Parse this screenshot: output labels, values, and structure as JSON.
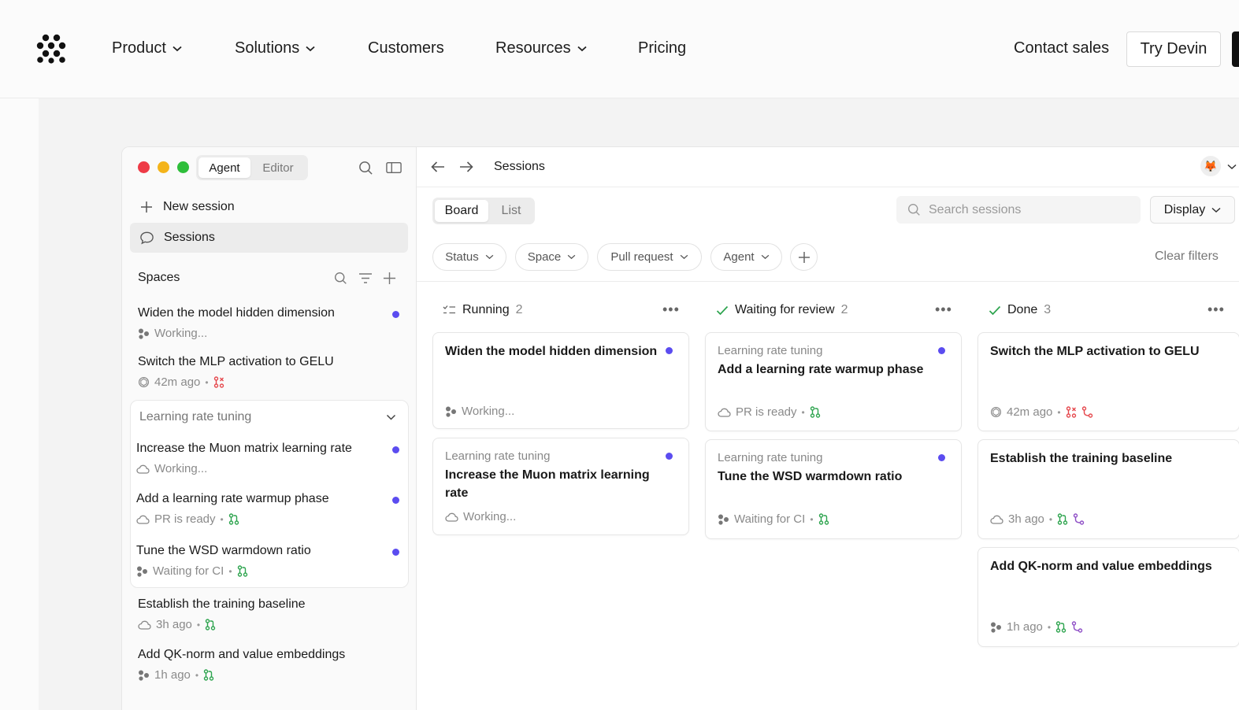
{
  "nav": {
    "items": [
      {
        "label": "Product",
        "has_menu": true
      },
      {
        "label": "Solutions",
        "has_menu": true
      },
      {
        "label": "Customers",
        "has_menu": false
      },
      {
        "label": "Resources",
        "has_menu": true
      },
      {
        "label": "Pricing",
        "has_menu": false
      }
    ],
    "contact_label": "Contact sales",
    "try_label": "Try Devin"
  },
  "sidebar": {
    "tabs": {
      "agent": "Agent",
      "editor": "Editor",
      "active": "Agent"
    },
    "new_session_label": "New session",
    "sessions_label": "Sessions",
    "spaces_title": "Spaces",
    "items": [
      {
        "title": "Widen the model hidden dimension",
        "meta": "Working...",
        "icon": "agent-icon",
        "unread": true
      },
      {
        "title": "Switch the MLP activation to GELU",
        "meta": "42m ago",
        "icon": "openai-icon",
        "pr_status": "pr-closed-icon"
      }
    ],
    "group": {
      "title": "Learning rate tuning",
      "items": [
        {
          "title": "Increase the Muon matrix learning rate",
          "meta": "Working...",
          "icon": "cloud-icon",
          "unread": true
        },
        {
          "title": "Add a learning rate warmup phase",
          "meta": "PR is ready",
          "icon": "cloud-icon",
          "unread": true,
          "pr_status": "pr-open-icon"
        },
        {
          "title": "Tune the WSD warmdown ratio",
          "meta": "Waiting for CI",
          "icon": "agent-icon",
          "unread": true,
          "pr_status": "pr-open-icon"
        }
      ]
    },
    "more_items": [
      {
        "title": "Establish the training baseline",
        "meta": "3h ago",
        "icon": "cloud-icon",
        "pr_status": "pr-open-icon"
      },
      {
        "title": "Add QK-norm and value embeddings",
        "meta": "1h ago",
        "icon": "agent-icon",
        "pr_status": "pr-open-icon"
      }
    ]
  },
  "main": {
    "breadcrumb": "Sessions",
    "view_tabs": {
      "board": "Board",
      "list": "List",
      "active": "Board"
    },
    "search_placeholder": "Search sessions",
    "display_label": "Display",
    "filters": [
      "Status",
      "Space",
      "Pull request",
      "Agent"
    ],
    "clear_filters_label": "Clear filters",
    "columns": [
      {
        "title": "Running",
        "count": "2",
        "icon": "running-icon",
        "cards": [
          {
            "space": "",
            "title": "Widen the model hidden dimension",
            "meta": "Working...",
            "icon": "agent-icon",
            "unread": true
          },
          {
            "space": "Learning rate tuning",
            "title": "Increase the Muon matrix learning rate",
            "meta": "Working...",
            "icon": "cloud-icon",
            "unread": true
          }
        ]
      },
      {
        "title": "Waiting for review",
        "count": "2",
        "icon": "check-icon",
        "cards": [
          {
            "space": "Learning rate tuning",
            "title": "Add a learning rate warmup phase",
            "meta": "PR is ready",
            "icon": "cloud-icon",
            "unread": true,
            "pr_status": "pr-open-icon"
          },
          {
            "space": "Learning rate tuning",
            "title": "Tune the WSD warmdown ratio",
            "meta": "Waiting for CI",
            "icon": "agent-icon",
            "unread": true,
            "pr_status": "pr-open-icon"
          }
        ]
      },
      {
        "title": "Done",
        "count": "3",
        "icon": "check-icon",
        "cards": [
          {
            "space": "",
            "title": "Switch the MLP activation to GELU",
            "meta": "42m ago",
            "icon": "openai-icon",
            "pr_status": "pr-closed-icon",
            "branch": "branch-icon"
          },
          {
            "space": "",
            "title": "Establish the training baseline",
            "meta": "3h ago",
            "icon": "cloud-icon",
            "pr_status": "pr-open-icon",
            "branch": "branch-icon"
          },
          {
            "space": "",
            "title": "Add QK-norm and value embeddings",
            "meta": "1h ago",
            "icon": "agent-icon",
            "pr_status": "pr-open-icon",
            "branch": "branch-icon"
          }
        ]
      }
    ]
  },
  "colors": {
    "accent_dot": "#5b4cf0",
    "pr_open": "#2da44e",
    "pr_closed": "#e5484d",
    "branch": "#8e4ec6",
    "check": "#2da44e"
  }
}
